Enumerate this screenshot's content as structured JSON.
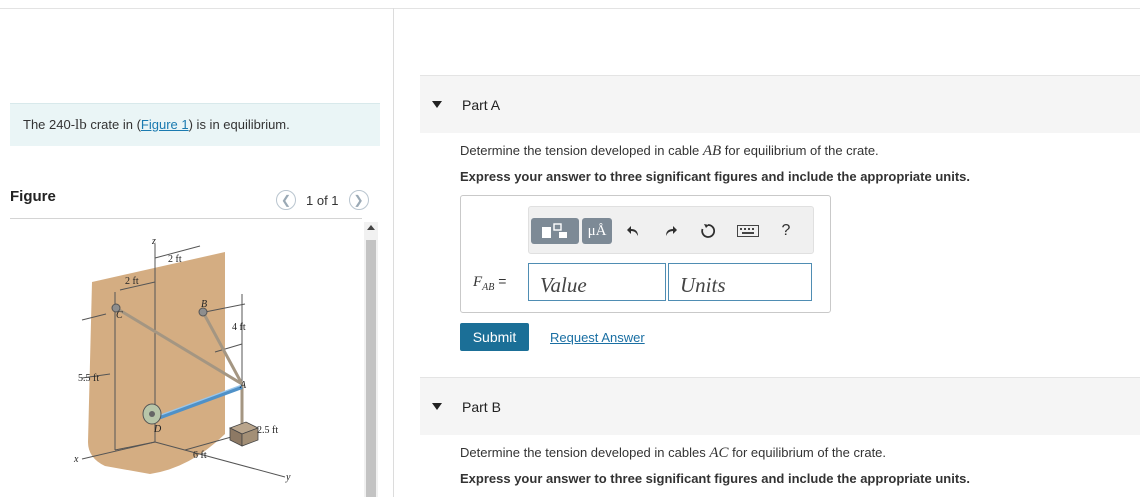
{
  "intro": {
    "prefix": "The 240-",
    "weight_unit": "lb",
    "mid": " crate in (",
    "link": "Figure 1",
    "suffix": ") is in equilibrium."
  },
  "figure_panel": {
    "title": "Figure",
    "pager": "1 of 1",
    "labels": {
      "z": "z",
      "x": "x",
      "y": "y",
      "dim_2ft_a": "2 ft",
      "dim_2ft_b": "2 ft",
      "dim_4ft": "4 ft",
      "dim_55ft": "5.5 ft",
      "dim_25ft": "2.5 ft",
      "dim_6ft": "6 ft",
      "pt_a": "A",
      "pt_b": "B",
      "pt_c": "C",
      "pt_d": "D"
    }
  },
  "part_a": {
    "label": "Part A",
    "question_prefix": "Determine the tension developed in cable ",
    "question_var": "AB",
    "question_suffix": " for equilibrium of the crate.",
    "instruction": "Express your answer to three significant figures and include the appropriate units.",
    "toolbar": {
      "templates_icon": "templates-icon",
      "units_label": "μÅ",
      "undo_icon": "undo-icon",
      "redo_icon": "redo-icon",
      "reset_icon": "reset-icon",
      "keyboard_icon": "keyboard-icon",
      "help_label": "?"
    },
    "answer_label": "F",
    "answer_sub": "AB",
    "answer_eq": " =",
    "value_placeholder": "Value",
    "units_placeholder": "Units",
    "submit": "Submit",
    "request": "Request Answer"
  },
  "part_b": {
    "label": "Part B",
    "question_prefix": "Determine the tension developed in cables ",
    "question_var": "AC",
    "question_suffix": " for equilibrium of the crate.",
    "instruction": "Express your answer to three significant figures and include the appropriate units."
  },
  "colors": {
    "accent": "#1b6f97",
    "link": "#1a7ab0",
    "wall": "#d4ad82",
    "intro_bg": "#eaf5f6"
  }
}
